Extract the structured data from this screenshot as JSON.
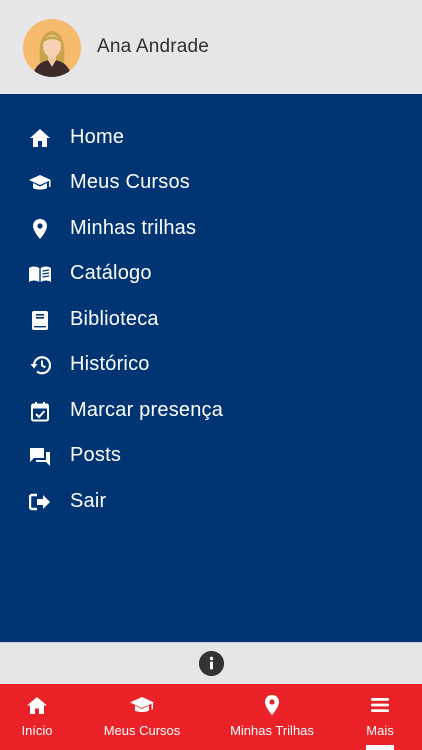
{
  "profile": {
    "name": "Ana Andrade",
    "avatar_icon": "avatar-woman-icon"
  },
  "menu": {
    "items": [
      {
        "label": "Home",
        "icon": "home-icon"
      },
      {
        "label": "Meus Cursos",
        "icon": "graduation-cap-icon"
      },
      {
        "label": "Minhas trilhas",
        "icon": "map-pin-icon"
      },
      {
        "label": "Catálogo",
        "icon": "open-book-icon"
      },
      {
        "label": "Biblioteca",
        "icon": "book-icon"
      },
      {
        "label": "Histórico",
        "icon": "history-icon"
      },
      {
        "label": "Marcar presença",
        "icon": "calendar-check-icon"
      },
      {
        "label": "Posts",
        "icon": "chat-bubbles-icon"
      },
      {
        "label": "Sair",
        "icon": "sign-out-icon"
      }
    ]
  },
  "info": {
    "icon": "info-icon"
  },
  "tabbar": {
    "tabs": [
      {
        "label": "Início",
        "icon": "home-icon"
      },
      {
        "label": "Meus Cursos",
        "icon": "graduation-cap-icon"
      },
      {
        "label": "Minhas Trilhas",
        "icon": "map-pin-icon"
      },
      {
        "label": "Mais",
        "icon": "menu-icon",
        "selected": true
      }
    ]
  },
  "colors": {
    "profile_bg": "#e6e6e8",
    "menu_bg": "#003472",
    "tabbar_bg": "#ea2227",
    "text_light": "#ffffff",
    "avatar_bg": "#f6bb6c"
  }
}
